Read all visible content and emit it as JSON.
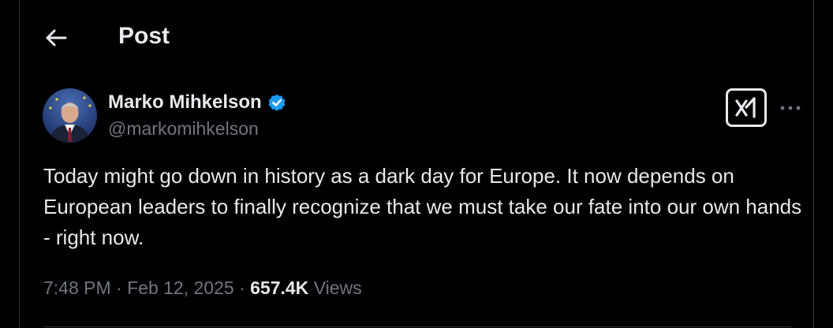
{
  "header": {
    "title": "Post"
  },
  "author": {
    "display_name": "Marko Mihkelson",
    "handle": "@markomihkelson",
    "verified": true
  },
  "post": {
    "text": "Today might go down in history as a dark day for Europe. It now depends on European leaders to finally recognize that we must take our fate into our own hands - right now.",
    "time": "7:48 PM",
    "separator": "·",
    "date": "Feb 12, 2025",
    "views_count": "657.4K",
    "views_label": "Views"
  },
  "colors": {
    "background": "#000000",
    "text_primary": "#e7e9ea",
    "text_secondary": "#71767b",
    "verified_blue": "#1d9bf0",
    "border": "#2f3336"
  },
  "icons": {
    "back": "arrow-left-icon",
    "verified": "verified-badge-icon",
    "grok": "grok-icon",
    "more": "more-horizontal-icon"
  }
}
